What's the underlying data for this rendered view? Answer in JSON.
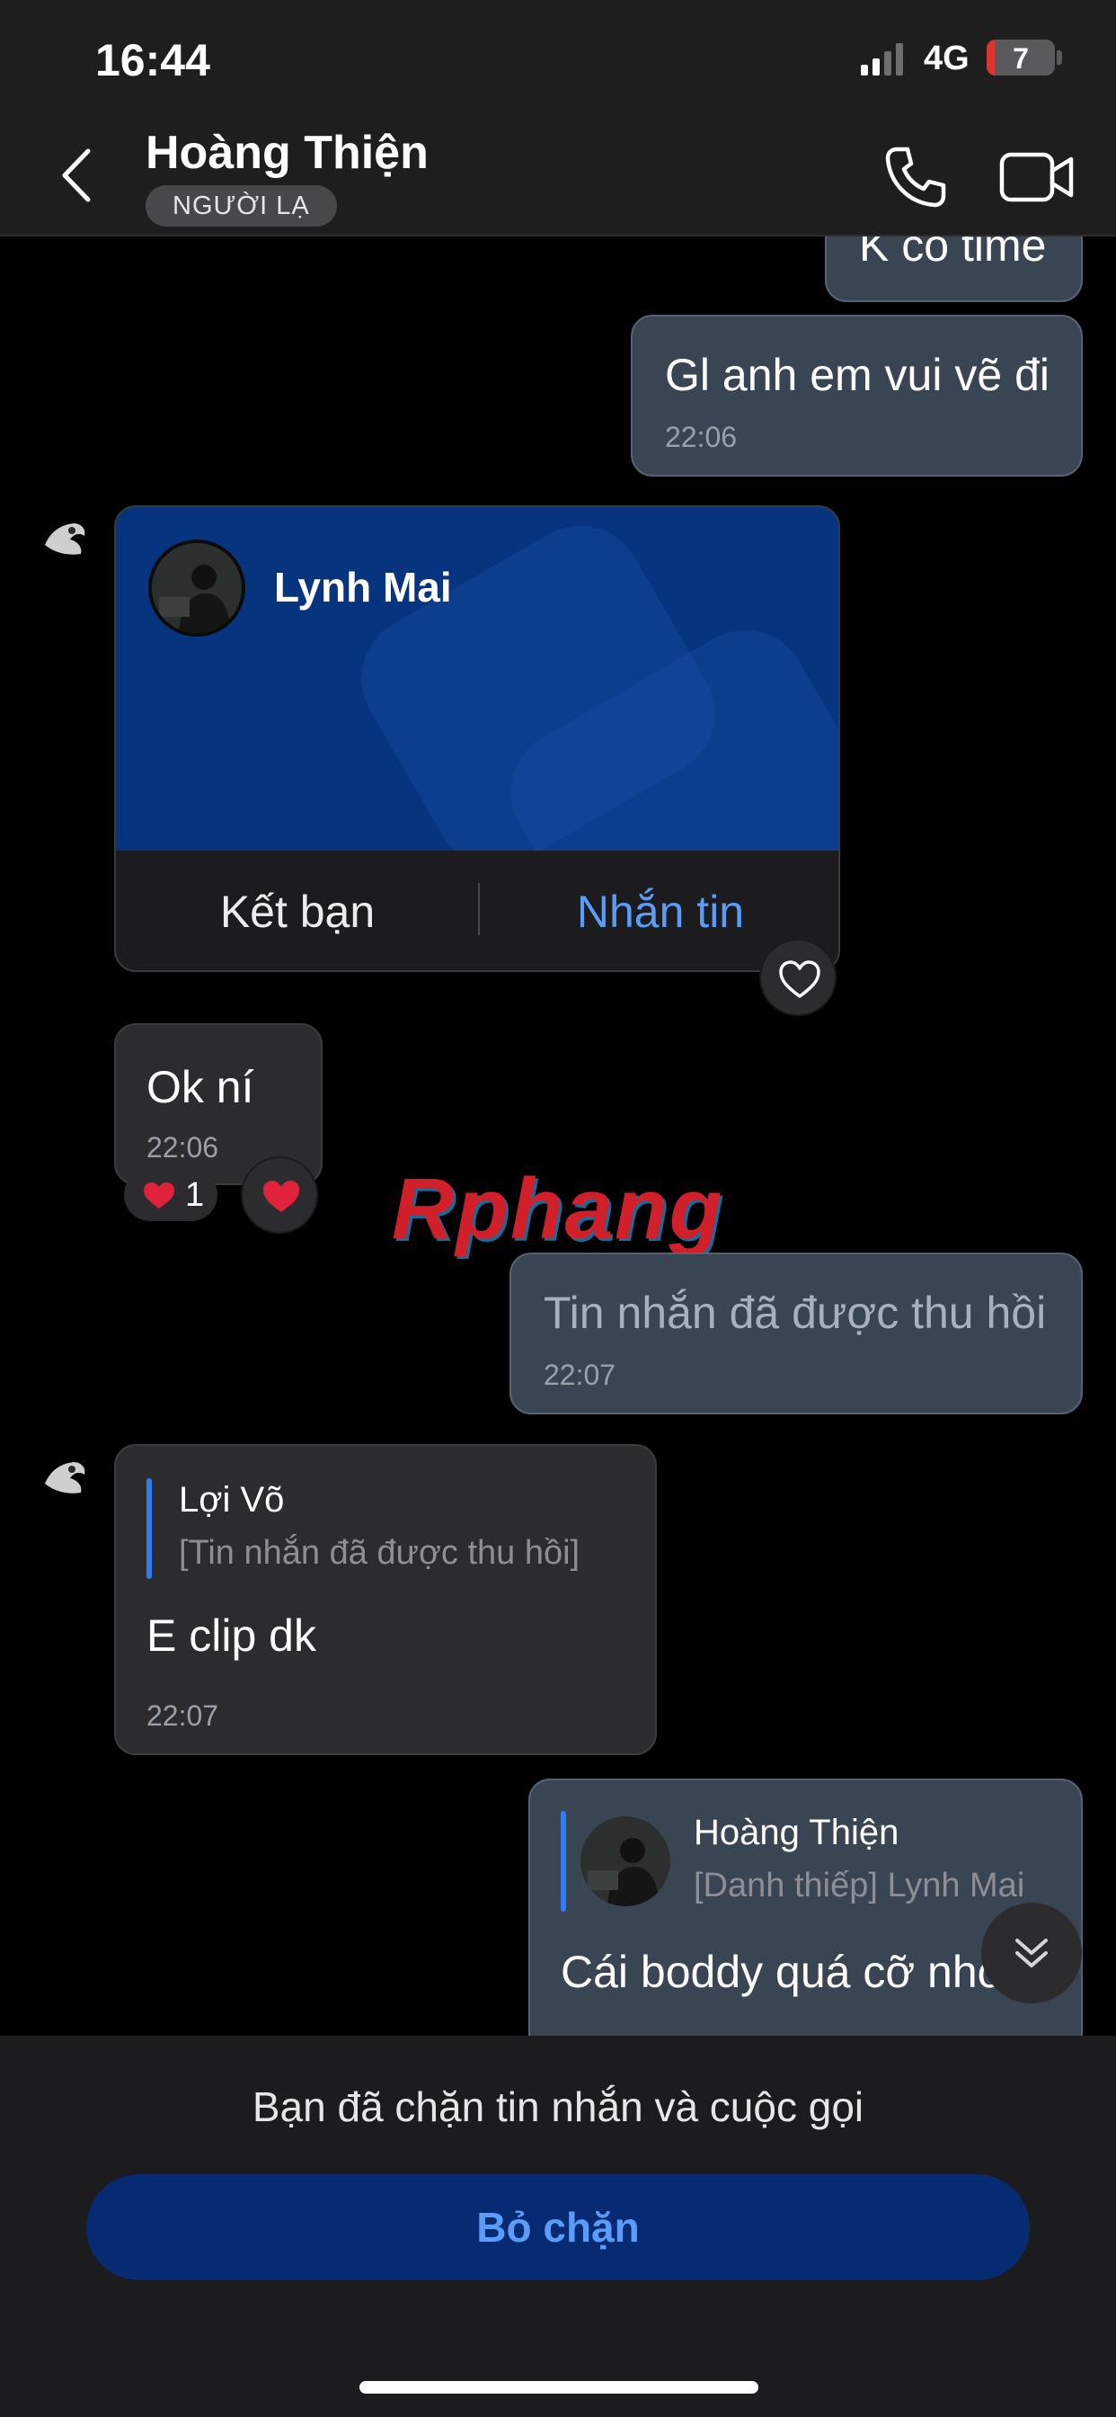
{
  "status_bar": {
    "time": "16:44",
    "network": "4G",
    "battery": "7",
    "battery_level": 0.07
  },
  "header": {
    "contact_name": "Hoàng Thiện",
    "badge": "NGƯỜI LẠ",
    "icons": {
      "back": "back-chevron-icon",
      "call": "phone-icon",
      "video": "video-camera-icon"
    }
  },
  "messages": {
    "m0": {
      "text": "K có time"
    },
    "m1": {
      "text": "Gl anh em vui vẽ đi",
      "time": "22:06"
    },
    "card": {
      "name": "Lynh Mai",
      "add_friend": "Kết bạn",
      "message": "Nhắn tin"
    },
    "m2": {
      "text": "Ok ní",
      "time": "22:06",
      "reaction_count": "1"
    },
    "m3": {
      "text": "Tin nhắn đã được thu hồi",
      "time": "22:07"
    },
    "m4": {
      "quote_author": "Lợi Võ",
      "quote_text": "[Tin nhắn đã được thu hồi]",
      "text": "E clip dk",
      "time": "22:07"
    },
    "m5": {
      "quote_author": "Hoàng Thiện",
      "quote_text": "[Danh thiếp] Lynh Mai",
      "text": "Cái boddy quá cỡ nhỏ"
    }
  },
  "watermark": "Rphang",
  "footer": {
    "blocked_text": "Bạn đã chặn tin nhắn và cuộc gọi",
    "unblock_label": "Bỏ chặn"
  },
  "colors": {
    "accent": "#5a9cf8",
    "outgoing_bubble": "#3a4554",
    "incoming_bubble": "#2c2c2e",
    "card_bg": "#06347f",
    "unblock_button": "#062b72",
    "reaction_heart": "#e0233a"
  }
}
